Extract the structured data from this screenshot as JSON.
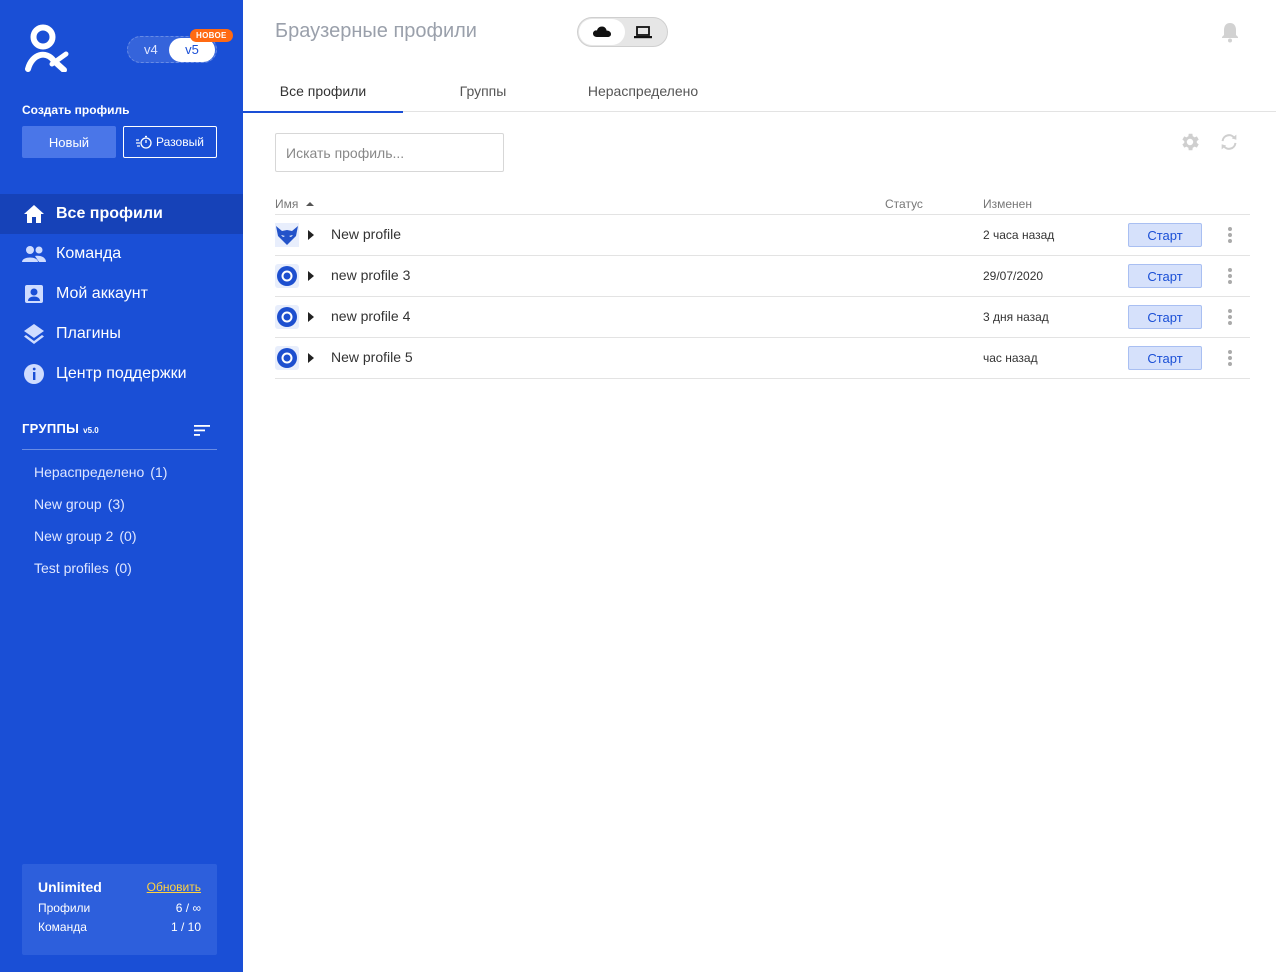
{
  "sidebar": {
    "version": {
      "v4": "v4",
      "v5": "v5",
      "badge": "НОВОЕ"
    },
    "create_label": "Создать профиль",
    "btn_new": "Новый",
    "btn_once": "Разовый",
    "nav": [
      {
        "label": "Все профили",
        "icon": "home-icon"
      },
      {
        "label": "Команда",
        "icon": "team-icon"
      },
      {
        "label": "Мой аккаунт",
        "icon": "account-icon"
      },
      {
        "label": "Плагины",
        "icon": "layers-icon"
      },
      {
        "label": "Центр поддержки",
        "icon": "info-icon"
      }
    ],
    "groups_title": "ГРУППЫ",
    "groups_version": "v5.0",
    "groups": [
      {
        "name": "Нераспределено",
        "count": "(1)"
      },
      {
        "name": "New group",
        "count": "(3)"
      },
      {
        "name": "New group 2",
        "count": "(0)"
      },
      {
        "name": "Test profiles",
        "count": "(0)"
      }
    ],
    "plan": {
      "name": "Unlimited",
      "upgrade": "Обновить",
      "profiles_label": "Профили",
      "profiles_value": "6 / ∞",
      "team_label": "Команда",
      "team_value": "1 / 10"
    }
  },
  "header": {
    "title": "Браузерные профили"
  },
  "tabs": [
    {
      "label": "Все профили"
    },
    {
      "label": "Группы"
    },
    {
      "label": "Нераспределено"
    }
  ],
  "search": {
    "placeholder": "Искать профиль..."
  },
  "table": {
    "columns": {
      "name": "Имя",
      "status": "Статус",
      "changed": "Изменен"
    },
    "rows": [
      {
        "name": "New profile",
        "status": "",
        "changed": "2 часа назад",
        "start": "Старт",
        "browser": "fox"
      },
      {
        "name": "new profile 3",
        "status": "",
        "changed": "29/07/2020",
        "start": "Старт",
        "browser": "orbita"
      },
      {
        "name": "new profile 4",
        "status": "",
        "changed": "3 дня назад",
        "start": "Старт",
        "browser": "orbita"
      },
      {
        "name": "New profile 5",
        "status": "",
        "changed": "час назад",
        "start": "Старт",
        "browser": "orbita"
      }
    ]
  },
  "colors": {
    "sidebar": "#1a4fd6",
    "accent": "#1a4fd6",
    "badge": "#ff6a13",
    "upgrade_link": "#ffd23f"
  }
}
